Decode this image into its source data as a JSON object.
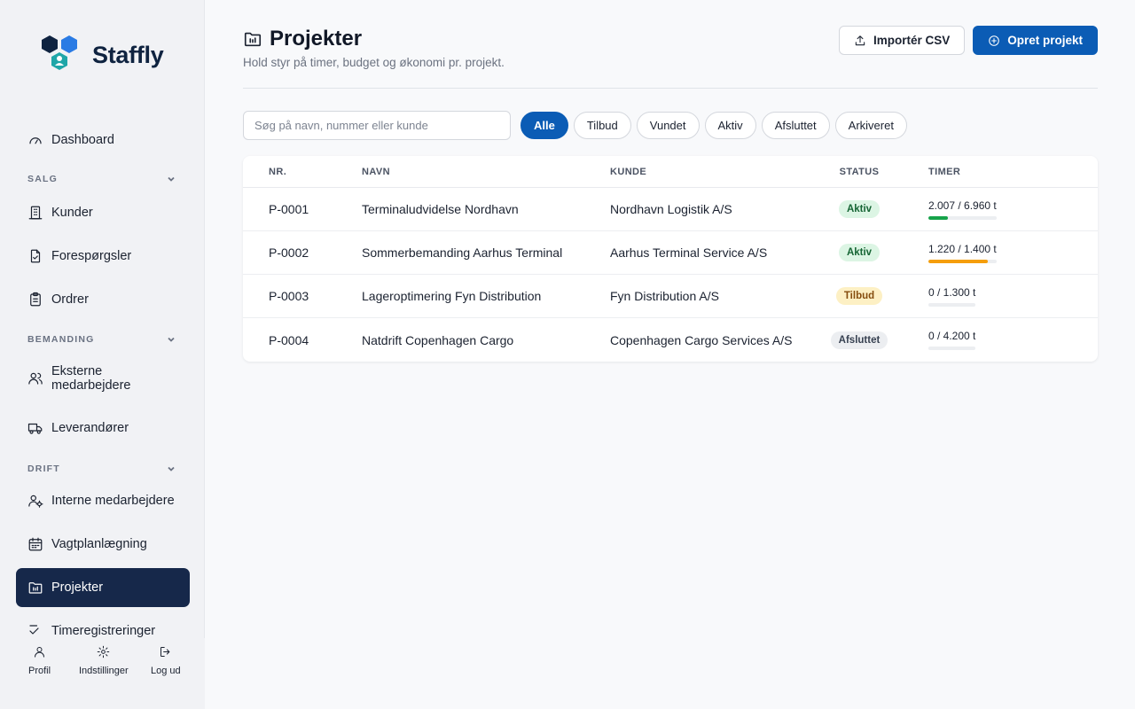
{
  "app": {
    "name": "Staffly"
  },
  "sidebar": {
    "dashboard": "Dashboard",
    "sections": {
      "salg": "SALG",
      "bemanding": "BEMANDING",
      "drift": "DRIFT"
    },
    "items": {
      "kunder": "Kunder",
      "forespoergsler": "Forespørgsler",
      "ordrer": "Ordrer",
      "eksterne": "Eksterne medarbejdere",
      "leverandoerer": "Leverandører",
      "interne": "Interne medarbejdere",
      "vagtplan": "Vagtplanlægning",
      "projekter": "Projekter",
      "timeregistreringer": "Timeregistreringer"
    },
    "footer": {
      "profil": "Profil",
      "indstillinger": "Indstillinger",
      "logud": "Log ud"
    }
  },
  "header": {
    "title": "Projekter",
    "subtitle": "Hold styr på timer, budget og økonomi pr. projekt.",
    "import_label": "Importér CSV",
    "create_label": "Opret projekt"
  },
  "filters": {
    "search_placeholder": "Søg på navn, nummer eller kunde",
    "chips": [
      "Alle",
      "Tilbud",
      "Vundet",
      "Aktiv",
      "Afsluttet",
      "Arkiveret"
    ],
    "active": "Alle"
  },
  "table": {
    "headers": {
      "nr": "NR.",
      "navn": "NAVN",
      "kunde": "KUNDE",
      "status": "STATUS",
      "timer": "TIMER"
    },
    "rows": [
      {
        "nr": "P-0001",
        "navn": "Terminaludvidelse Nordhavn",
        "kunde": "Nordhavn Logistik A/S",
        "status": "Aktiv",
        "timer": "2.007 / 6.960 t",
        "progress": 0.29,
        "bar_color": "#16a34a"
      },
      {
        "nr": "P-0002",
        "navn": "Sommerbemanding Aarhus Terminal",
        "kunde": "Aarhus Terminal Service A/S",
        "status": "Aktiv",
        "timer": "1.220 / 1.400 t",
        "progress": 0.87,
        "bar_color": "#f59e0b"
      },
      {
        "nr": "P-0003",
        "navn": "Lageroptimering Fyn Distribution",
        "kunde": "Fyn Distribution A/S",
        "status": "Tilbud",
        "timer": "0 / 1.300 t",
        "progress": 0,
        "bar_color": "#16a34a"
      },
      {
        "nr": "P-0004",
        "navn": "Natdrift Copenhagen Cargo",
        "kunde": "Copenhagen Cargo Services A/S",
        "status": "Afsluttet",
        "timer": "0 / 4.200 t",
        "progress": 0,
        "bar_color": "#16a34a"
      }
    ]
  },
  "status_colors": {
    "Aktiv": {
      "bg": "#dcf5e4",
      "fg": "#166534"
    },
    "Tilbud": {
      "bg": "#fdf0c4",
      "fg": "#854d0e"
    },
    "Afsluttet": {
      "bg": "#eceef1",
      "fg": "#374151"
    }
  },
  "colors": {
    "accent": "#0b5cb5",
    "nav_active": "#16284a"
  }
}
